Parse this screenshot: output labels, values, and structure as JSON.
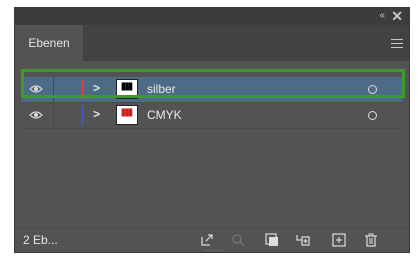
{
  "panel": {
    "tab_label": "Ebenen",
    "collapse_glyph": "«",
    "close_glyph": "✕"
  },
  "layers": [
    {
      "name": "silber",
      "color": "#e23b3b",
      "selected": true
    },
    {
      "name": "CMYK",
      "color": "#3b55c8",
      "selected": false
    }
  ],
  "footer": {
    "count_label": "2 Eb...",
    "icons": [
      "export-icon",
      "search-icon",
      "clip-mask-icon",
      "new-sublayer-icon",
      "new-layer-icon",
      "trash-icon"
    ]
  },
  "colors": {
    "panel_bg": "#535353",
    "selected_row": "#4d6a86",
    "highlight_box": "#3e9a2a"
  }
}
